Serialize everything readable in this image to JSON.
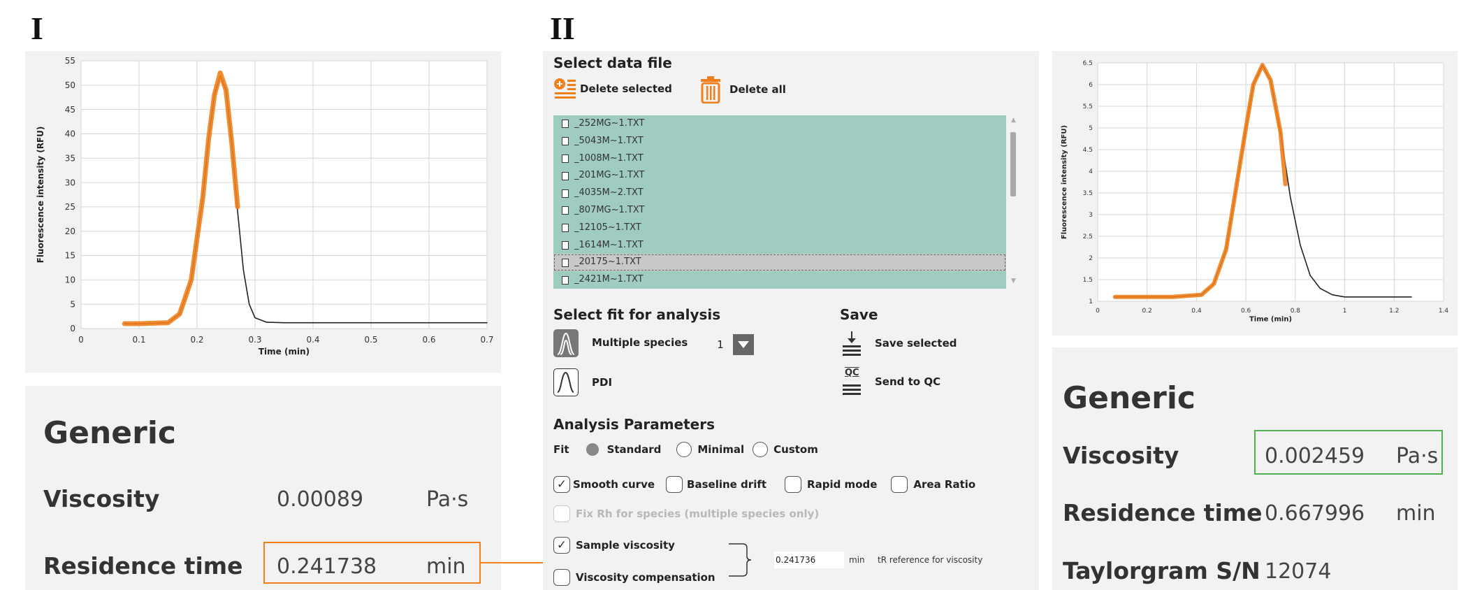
{
  "panel_labels": {
    "one": "I",
    "two": "II"
  },
  "left_chart": {
    "ylabel": "Fluorescence intensity (RFU)",
    "xlabel": "Time (min)",
    "x_ticks": [
      "0",
      "0.1",
      "0.2",
      "0.3",
      "0.4",
      "0.5",
      "0.6",
      "0.7"
    ],
    "y_ticks": [
      "0",
      "5",
      "10",
      "15",
      "20",
      "25",
      "30",
      "35",
      "40",
      "45",
      "50",
      "55"
    ]
  },
  "right_chart": {
    "ylabel": "Fluorescence intensity (RFU)",
    "xlabel": "Time (min)",
    "x_ticks": [
      "0",
      "0.2",
      "0.4",
      "0.6",
      "0.8",
      "1",
      "1.2",
      "1.4"
    ],
    "y_ticks": [
      "1",
      "1.5",
      "2",
      "2.5",
      "3",
      "3.5",
      "4",
      "4.5",
      "5",
      "5.5",
      "6",
      "6.5"
    ]
  },
  "chart_data": [
    {
      "type": "line",
      "xlabel": "Time (min)",
      "ylabel": "Fluorescence intensity (RFU)",
      "xlim": [
        0,
        0.7
      ],
      "ylim": [
        0,
        55
      ],
      "grid": true,
      "series": [
        {
          "color": "#222222",
          "x": [
            0.075,
            0.1,
            0.15,
            0.17,
            0.19,
            0.21,
            0.22,
            0.23,
            0.24,
            0.25,
            0.26,
            0.27,
            0.28,
            0.29,
            0.3,
            0.32,
            0.35,
            0.4,
            0.5,
            0.6,
            0.7
          ],
          "y": [
            1,
            1,
            1.2,
            3,
            10,
            27,
            39,
            48,
            52,
            49,
            38,
            24,
            12,
            5,
            2.2,
            1.3,
            1.2,
            1.2,
            1.2,
            1.2,
            1.2
          ]
        },
        {
          "color": "#f07f1c",
          "x": [
            0.075,
            0.1,
            0.15,
            0.17,
            0.19,
            0.21,
            0.22,
            0.23,
            0.24,
            0.25,
            0.26,
            0.27
          ],
          "y": [
            1,
            1,
            1.2,
            3,
            10,
            27,
            39,
            48,
            52.5,
            49,
            38,
            25
          ]
        }
      ]
    },
    {
      "type": "line",
      "xlabel": "Time (min)",
      "ylabel": "Fluorescence intensity (RFU)",
      "xlim": [
        0,
        1.4
      ],
      "ylim": [
        1,
        6.5
      ],
      "grid": true,
      "series": [
        {
          "color": "#222222",
          "x": [
            0.07,
            0.3,
            0.42,
            0.47,
            0.52,
            0.56,
            0.6,
            0.63,
            0.667,
            0.7,
            0.74,
            0.78,
            0.82,
            0.86,
            0.9,
            0.95,
            1.0,
            1.1,
            1.27
          ],
          "y": [
            1.1,
            1.1,
            1.15,
            1.4,
            2.2,
            3.6,
            5.0,
            6.0,
            6.45,
            6.1,
            4.9,
            3.4,
            2.3,
            1.6,
            1.3,
            1.15,
            1.1,
            1.1,
            1.1
          ]
        },
        {
          "color": "#f07f1c",
          "x": [
            0.07,
            0.3,
            0.42,
            0.47,
            0.52,
            0.56,
            0.6,
            0.63,
            0.667,
            0.7,
            0.74,
            0.76
          ],
          "y": [
            1.1,
            1.1,
            1.15,
            1.4,
            2.2,
            3.6,
            5.0,
            6.0,
            6.45,
            6.1,
            4.9,
            3.7
          ]
        }
      ]
    }
  ],
  "left_results": {
    "title": "Generic",
    "rows": [
      {
        "label": "Viscosity",
        "value": "0.00089",
        "unit": "Pa·s"
      },
      {
        "label": "Residence time",
        "value": "0.241738",
        "unit": "min"
      }
    ]
  },
  "right_results": {
    "title": "Generic",
    "rows": [
      {
        "label": "Viscosity",
        "value": "0.002459",
        "unit": "Pa·s"
      },
      {
        "label": "Residence time",
        "value": "0.667996",
        "unit": "min"
      },
      {
        "label": "Taylorgram S/N",
        "value": "12074",
        "unit": ""
      }
    ]
  },
  "app": {
    "select_file_title": "Select data file",
    "delete_selected": "Delete selected",
    "delete_all": "Delete all",
    "files": [
      "_252MG~1.TXT",
      "_5043M~1.TXT",
      "_1008M~1.TXT",
      "_201MG~1.TXT",
      "_4035M~2.TXT",
      "_807MG~1.TXT",
      "_12105~1.TXT",
      "_1614M~1.TXT",
      "_20175~1.TXT",
      "_2421M~1.TXT"
    ],
    "selected_file_index": 8,
    "fit_title": "Select fit for analysis",
    "multiple_species": "Multiple species",
    "species_count": "1",
    "pdi": "PDI",
    "save_title": "Save",
    "save_selected": "Save selected",
    "qc_icon_text": "QC",
    "send_to_qc": "Send to QC",
    "params_title": "Analysis Parameters",
    "fit_label": "Fit",
    "fit_options": [
      "Standard",
      "Minimal",
      "Custom"
    ],
    "fit_selected": "Standard",
    "smooth_curve": "Smooth curve",
    "baseline_drift": "Baseline drift",
    "rapid_mode": "Rapid mode",
    "area_ratio": "Area Ratio",
    "fix_rh": "Fix Rh for species (multiple species only)",
    "sample_viscosity": "Sample viscosity",
    "viscosity_compensation": "Viscosity compensation",
    "tr_value": "0.241736",
    "tr_unit": "min",
    "tr_label": "tR reference for viscosity",
    "colors": {
      "list_bg": "#9fcbc0",
      "accent": "#f07f1c",
      "highlight_green": "#4caf50"
    }
  }
}
